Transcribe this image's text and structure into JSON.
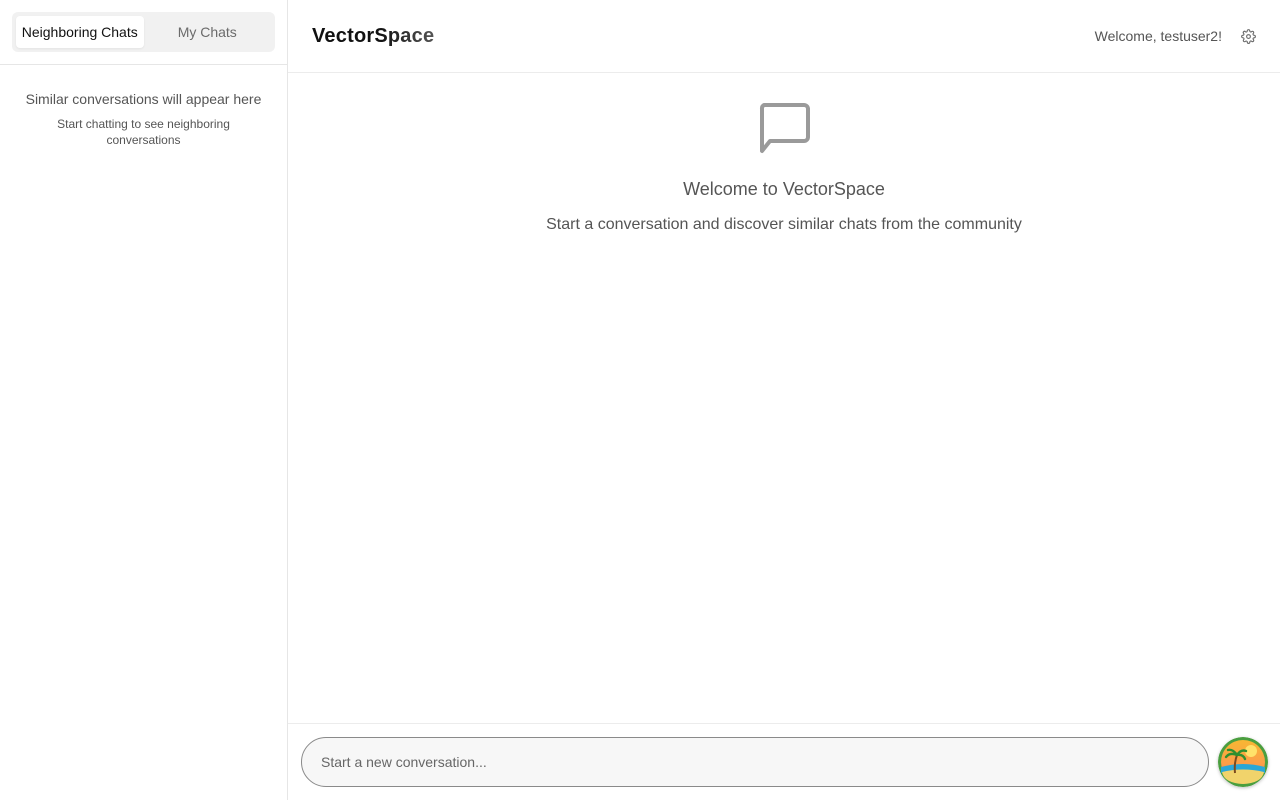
{
  "sidebar": {
    "tabs": [
      {
        "label": "Neighboring Chats",
        "active": true
      },
      {
        "label": "My Chats",
        "active": false
      }
    ],
    "empty_title": "Similar conversations will appear here",
    "empty_subtitle": "Start chatting to see neighboring conversations"
  },
  "header": {
    "brand": "VectorSpace",
    "welcome": "Welcome, testuser2!",
    "settings_icon": "gear-icon"
  },
  "main": {
    "icon": "chat-bubble-icon",
    "title": "Welcome to VectorSpace",
    "subtitle": "Start a conversation and discover similar chats from the community"
  },
  "composer": {
    "placeholder": "Start a new conversation...",
    "send_icon": "beach-sunset-icon"
  },
  "colors": {
    "border": "#e6e6e6",
    "muted_text": "#555555",
    "icon_gray": "#9a9a9a",
    "tab_bg": "#f1f1f1"
  }
}
